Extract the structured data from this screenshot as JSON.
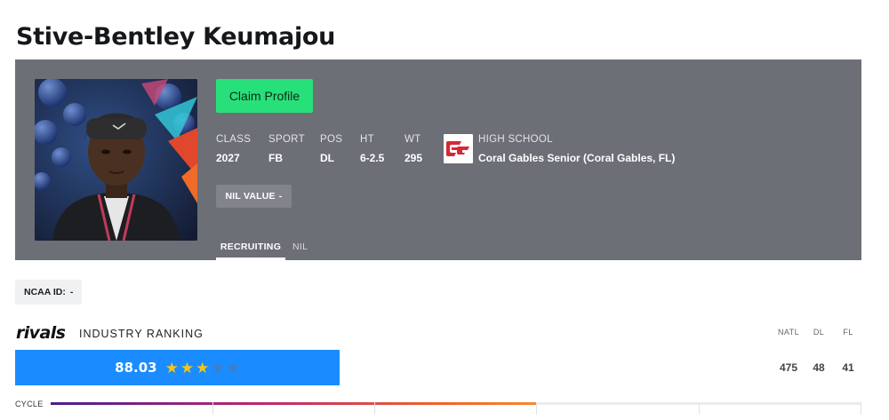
{
  "player": {
    "name": "Stive-Bentley Keumajou"
  },
  "hero": {
    "claim_label": "Claim Profile",
    "stats": [
      {
        "label": "CLASS",
        "value": "2027"
      },
      {
        "label": "SPORT",
        "value": "FB"
      },
      {
        "label": "POS",
        "value": "DL"
      },
      {
        "label": "HT",
        "value": "6-2.5"
      },
      {
        "label": "WT",
        "value": "295"
      }
    ],
    "school": {
      "label": "HIGH SCHOOL",
      "value": "Coral Gables Senior (Coral Gables, FL)",
      "logo_color": "#d42a35"
    },
    "nil_label": "NIL VALUE",
    "nil_value": "-",
    "tabs": [
      "RECRUITING",
      "NIL"
    ],
    "active_tab": "RECRUITING"
  },
  "ncaa": {
    "label": "NCAA ID:",
    "value": "-"
  },
  "ranking": {
    "brand": "rivals",
    "label": "INDUSTRY RANKING",
    "rating": "88.03",
    "stars": 3,
    "max_stars": 5,
    "columns": [
      {
        "label": "NATL",
        "value": "475"
      },
      {
        "label": "DL",
        "value": "48"
      },
      {
        "label": "FL",
        "value": "41"
      }
    ],
    "cycle_label": "CYCLE",
    "cycle_progress": 0.6
  },
  "colors": {
    "hero_bg": "#6d6f77",
    "claim": "#28e07a",
    "rating_bar": "#1a8cff",
    "star": "#f5c518"
  },
  "icons": {
    "star": "star-icon"
  }
}
